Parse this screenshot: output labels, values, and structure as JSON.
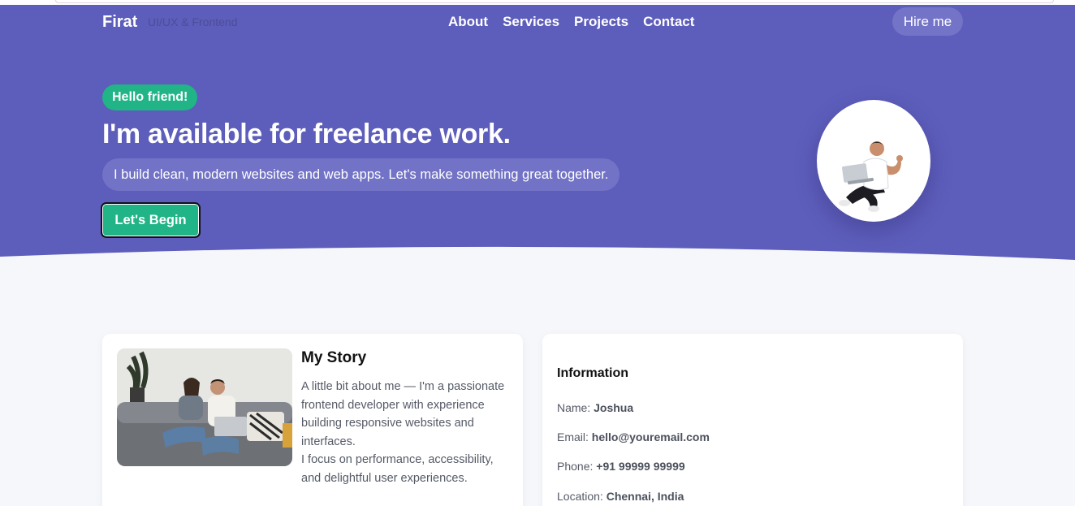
{
  "header": {
    "brand": "Firat",
    "tagline": "UI/UX & Frontend",
    "nav": [
      {
        "label": "About"
      },
      {
        "label": "Services"
      },
      {
        "label": "Projects"
      },
      {
        "label": "Contact"
      }
    ],
    "cta": "Hire me"
  },
  "hero": {
    "badge": "Hello friend!",
    "title": "I'm available for freelance work.",
    "subtitle": "I build clean, modern websites and web apps. Let's make something great together.",
    "button": "Let's Begin"
  },
  "story": {
    "title": "My Story",
    "line1": "A little bit about me — I'm a passionate frontend developer with experience building responsive websites and interfaces.",
    "line2": "I focus on performance, accessibility, and delightful user experiences."
  },
  "info": {
    "title": "Information",
    "rows": [
      {
        "label": "Name:",
        "value": "Joshua"
      },
      {
        "label": "Email:",
        "value": "hello@youremail.com"
      },
      {
        "label": "Phone:",
        "value": "+91 99999 99999"
      },
      {
        "label": "Location:",
        "value": "Chennai, India"
      }
    ]
  },
  "colors": {
    "hero": "#5d5dbb",
    "accent": "#20b486",
    "background": "#f6f7fb"
  }
}
